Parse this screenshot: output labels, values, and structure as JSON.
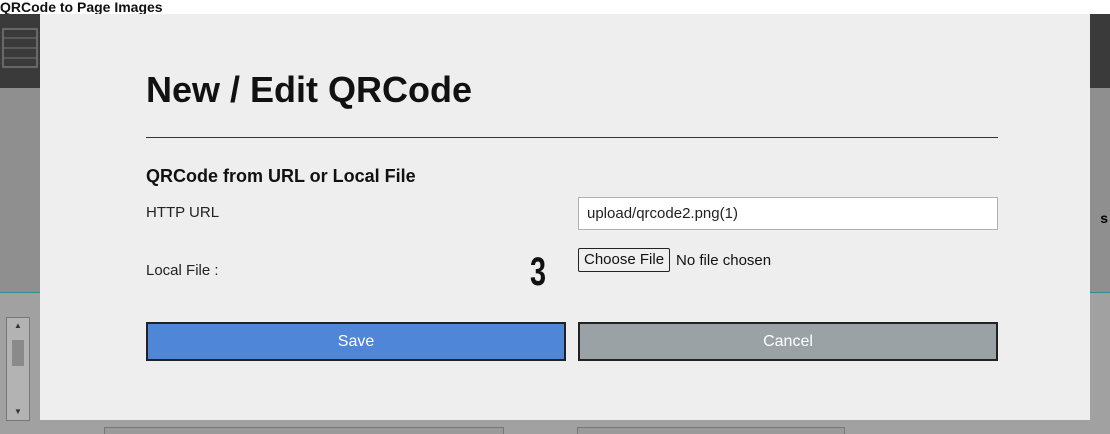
{
  "caption": {
    "text": "QRCode to Page Images"
  },
  "background": {
    "partial_letter": "s"
  },
  "modal": {
    "title": "New / Edit QRCode",
    "section_title": "QRCode from URL or Local File",
    "url_label": "HTTP URL",
    "url_value": "upload/qrcode2.png(1)",
    "local_file_label": "Local File :",
    "step_marker": "3",
    "choose_file_label": "Choose File",
    "no_file_text": "No file chosen",
    "save_label": "Save",
    "cancel_label": "Cancel"
  },
  "colors": {
    "save_button": "#4f86d8",
    "cancel_button": "#9aa2a6",
    "modal_background": "#eeeeee",
    "overlay": "#8e8e8e"
  }
}
